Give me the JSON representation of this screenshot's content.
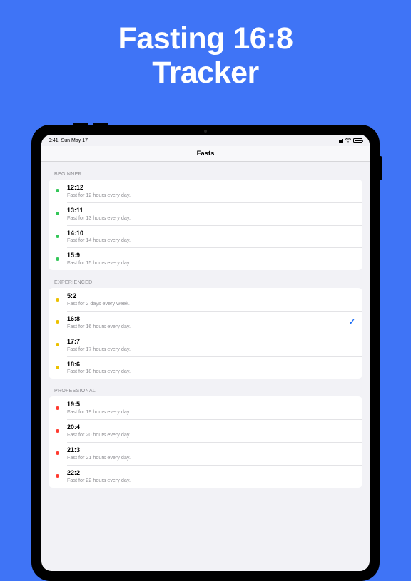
{
  "promo": {
    "line1": "Fasting 16:8",
    "line2": "Tracker"
  },
  "status": {
    "time": "9:41",
    "date": "Sun May 17"
  },
  "nav": {
    "title": "Fasts"
  },
  "sections": {
    "beginner": {
      "header": "BEGINNER",
      "items": [
        {
          "title": "12:12",
          "sub": "Fast for 12 hours every day."
        },
        {
          "title": "13:11",
          "sub": "Fast for 13 hours every day."
        },
        {
          "title": "14:10",
          "sub": "Fast for 14 hours every day."
        },
        {
          "title": "15:9",
          "sub": "Fast for 15 hours every day."
        }
      ]
    },
    "experienced": {
      "header": "EXPERIENCED",
      "items": [
        {
          "title": "5:2",
          "sub": "Fast for 2 days every week."
        },
        {
          "title": "16:8",
          "sub": "Fast for 16 hours every day.",
          "selected": true
        },
        {
          "title": "17:7",
          "sub": "Fast for 17 hours every day."
        },
        {
          "title": "18:6",
          "sub": "Fast for 18 hours every day."
        }
      ]
    },
    "professional": {
      "header": "PROFESSIONAL",
      "items": [
        {
          "title": "19:5",
          "sub": "Fast for 19 hours every day."
        },
        {
          "title": "20:4",
          "sub": "Fast for 20 hours every day."
        },
        {
          "title": "21:3",
          "sub": "Fast for 21 hours every day."
        },
        {
          "title": "22:2",
          "sub": "Fast for 22 hours every day."
        }
      ]
    }
  },
  "checkmark": "✓"
}
